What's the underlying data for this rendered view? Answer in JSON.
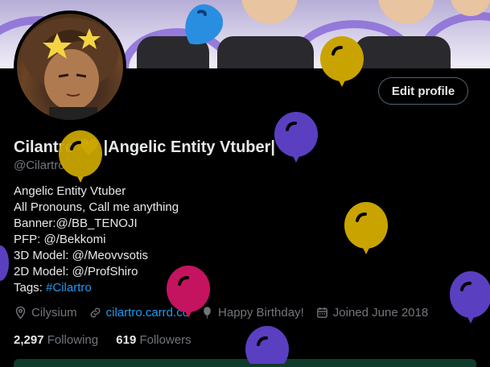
{
  "banner": {
    "art_icon": "illustrated-banner"
  },
  "profile": {
    "display_name": "Cilantro",
    "name_emoji": "💛",
    "name_suffix": " |Angelic Entity Vtuber|",
    "handle": "@Cilartro",
    "edit_button": "Edit profile",
    "bio": {
      "line1": "Angelic Entity Vtuber",
      "line2": "All Pronouns, Call me anything",
      "line3_prefix": "Banner:",
      "line3_mention": "@/BB_TENOJI",
      "line4_prefix": "PFP: ",
      "line4_mention": "@/Bekkomi",
      "line5_prefix": "3D Model: ",
      "line5_mention": "@/Meovvsotis",
      "line6_prefix": "2D Model: ",
      "line6_mention": "@/ProfShiro",
      "line7_prefix": "Tags: ",
      "line7_tag": "#Cilartro"
    },
    "location": "Cilysium",
    "website": "cilartro.carrd.co",
    "birthday": "Happy Birthday!",
    "joined": "Joined June 2018",
    "following_count": "2,297",
    "following_label": "Following",
    "followers_count": "619",
    "followers_label": "Followers"
  },
  "colors": {
    "accent": "#1d9bf0",
    "balloon_gold": "#c9a400",
    "balloon_purple": "#5a3fc0",
    "balloon_pink": "#c4145f",
    "balloon_blue": "#2a8ee0"
  }
}
